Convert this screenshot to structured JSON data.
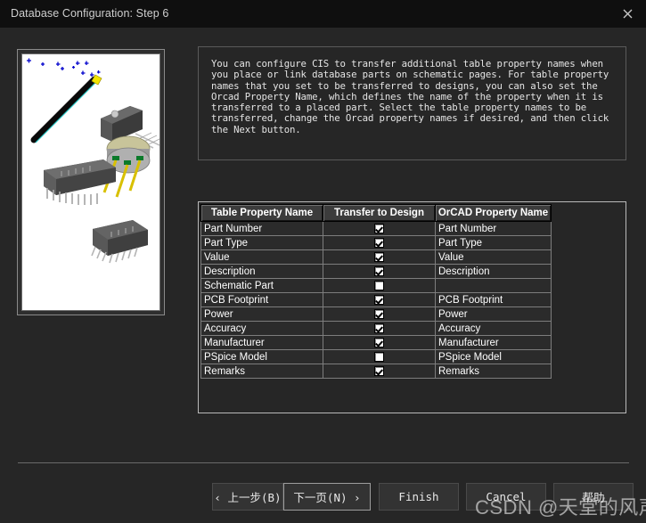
{
  "window": {
    "title": "Database Configuration: Step 6",
    "close_icon": "close-icon"
  },
  "illustration": {
    "alt": "orcad-cis-parts-illustration",
    "background": "#ffffff",
    "sparkle_color": "#0000cc",
    "wand_color": "#000000",
    "lead_color": "#d8c000"
  },
  "description": {
    "text": "You can configure CIS to transfer additional table property names when you place or link database parts on schematic pages. For table property names that you set to be transferred to designs, you can also set the Orcad Property Name, which defines the name of the property when it is transferred to a placed part. Select the table property names to be transferred, change the Orcad property names if desired, and then click the Next button."
  },
  "table": {
    "headers": {
      "name": "Table Property Name",
      "transfer": "Transfer to Design",
      "orcad": "OrCAD Property Name"
    },
    "rows": [
      {
        "name": "Part Number",
        "checked": true,
        "orcad": "Part Number",
        "dim": false,
        "selected": false,
        "check_highlight": true
      },
      {
        "name": "Part Type",
        "checked": true,
        "orcad": "Part Type",
        "dim": false,
        "selected": false,
        "check_highlight": false
      },
      {
        "name": "Value",
        "checked": true,
        "orcad": "Value",
        "dim": true,
        "selected": false,
        "check_highlight": true
      },
      {
        "name": "Description",
        "checked": true,
        "orcad": "Description",
        "dim": false,
        "selected": false,
        "check_highlight": false
      },
      {
        "name": "Schematic Part",
        "checked": false,
        "orcad": "",
        "dim": false,
        "selected": true,
        "check_highlight": true
      },
      {
        "name": "PCB Footprint",
        "checked": true,
        "orcad": "PCB Footprint",
        "dim": false,
        "selected": false,
        "check_highlight": false
      },
      {
        "name": "Power",
        "checked": true,
        "orcad": "Power",
        "dim": false,
        "selected": false,
        "check_highlight": false
      },
      {
        "name": "Accuracy",
        "checked": true,
        "orcad": "Accuracy",
        "dim": false,
        "selected": false,
        "check_highlight": false
      },
      {
        "name": "Manufacturer",
        "checked": true,
        "orcad": "Manufacturer",
        "dim": false,
        "selected": false,
        "check_highlight": false
      },
      {
        "name": "PSpice Model",
        "checked": false,
        "orcad": "PSpice Model",
        "dim": false,
        "selected": false,
        "check_highlight": false
      },
      {
        "name": "Remarks",
        "checked": true,
        "orcad": "Remarks",
        "dim": false,
        "selected": false,
        "check_highlight": false
      }
    ]
  },
  "buttons": {
    "back": "‹ 上一步(B)",
    "next": "下一页(N) ›",
    "finish": "Finish",
    "cancel": "Cancel",
    "help": "帮助"
  },
  "watermark": {
    "text": "CSDN @天堂的风声"
  }
}
